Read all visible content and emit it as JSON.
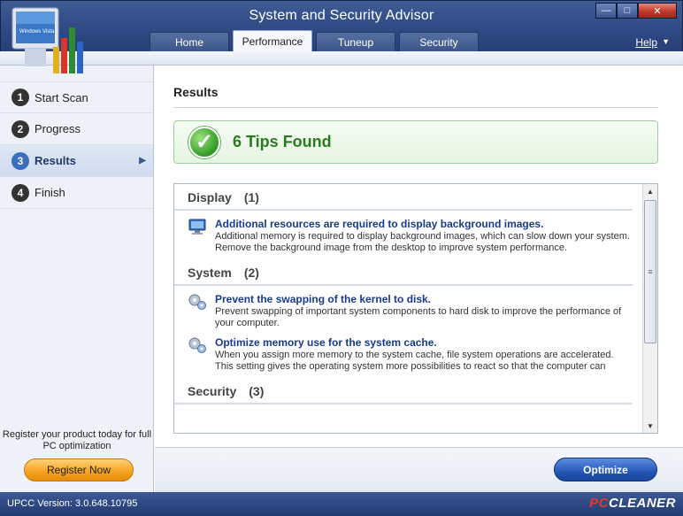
{
  "window": {
    "title": "System and Security Advisor",
    "logo_text": "Windows Vista"
  },
  "tabs": [
    {
      "label": "Home",
      "active": false
    },
    {
      "label": "Performance",
      "active": true
    },
    {
      "label": "Tuneup",
      "active": false
    },
    {
      "label": "Security",
      "active": false
    }
  ],
  "help_label": "Help",
  "sidebar": {
    "steps": [
      {
        "num": "1",
        "label": "Start Scan"
      },
      {
        "num": "2",
        "label": "Progress"
      },
      {
        "num": "3",
        "label": "Results"
      },
      {
        "num": "4",
        "label": "Finish"
      }
    ],
    "active_step": "Results",
    "register_text": "Register your product today for full PC optimization",
    "register_button": "Register Now"
  },
  "main": {
    "heading": "Results",
    "tips_found": "6 Tips Found",
    "sections": [
      {
        "title": "Display",
        "count": "(1)",
        "items": [
          {
            "icon": "monitor-icon",
            "title": "Additional resources are required to display background images.",
            "desc": "Additional memory is required to display background images, which can slow down your system. Remove the background image from the desktop to improve system performance."
          }
        ]
      },
      {
        "title": "System",
        "count": "(2)",
        "items": [
          {
            "icon": "gears-icon",
            "title": "Prevent the swapping of the kernel to disk.",
            "desc": "Prevent swapping of important system components to hard disk to improve the performance of your computer."
          },
          {
            "icon": "gears-icon",
            "title": "Optimize memory use for the system cache.",
            "desc": "When you assign more memory to the system cache, file system operations are accelerated. This setting gives the operating system more possibilities to react so that the computer can"
          }
        ]
      },
      {
        "title": "Security",
        "count": "(3)",
        "items": []
      }
    ],
    "optimize_button": "Optimize"
  },
  "status": {
    "version": "UPCC Version: 3.0.648.10795",
    "brand_pc": "PC",
    "brand_cleaner": "CLEANER"
  },
  "colors": {
    "title_bar": "#2c4680",
    "accent_green": "#2a7a1f",
    "link_blue": "#163b8c",
    "register_orange": "#f5a623",
    "optimize_blue": "#2457b8"
  }
}
